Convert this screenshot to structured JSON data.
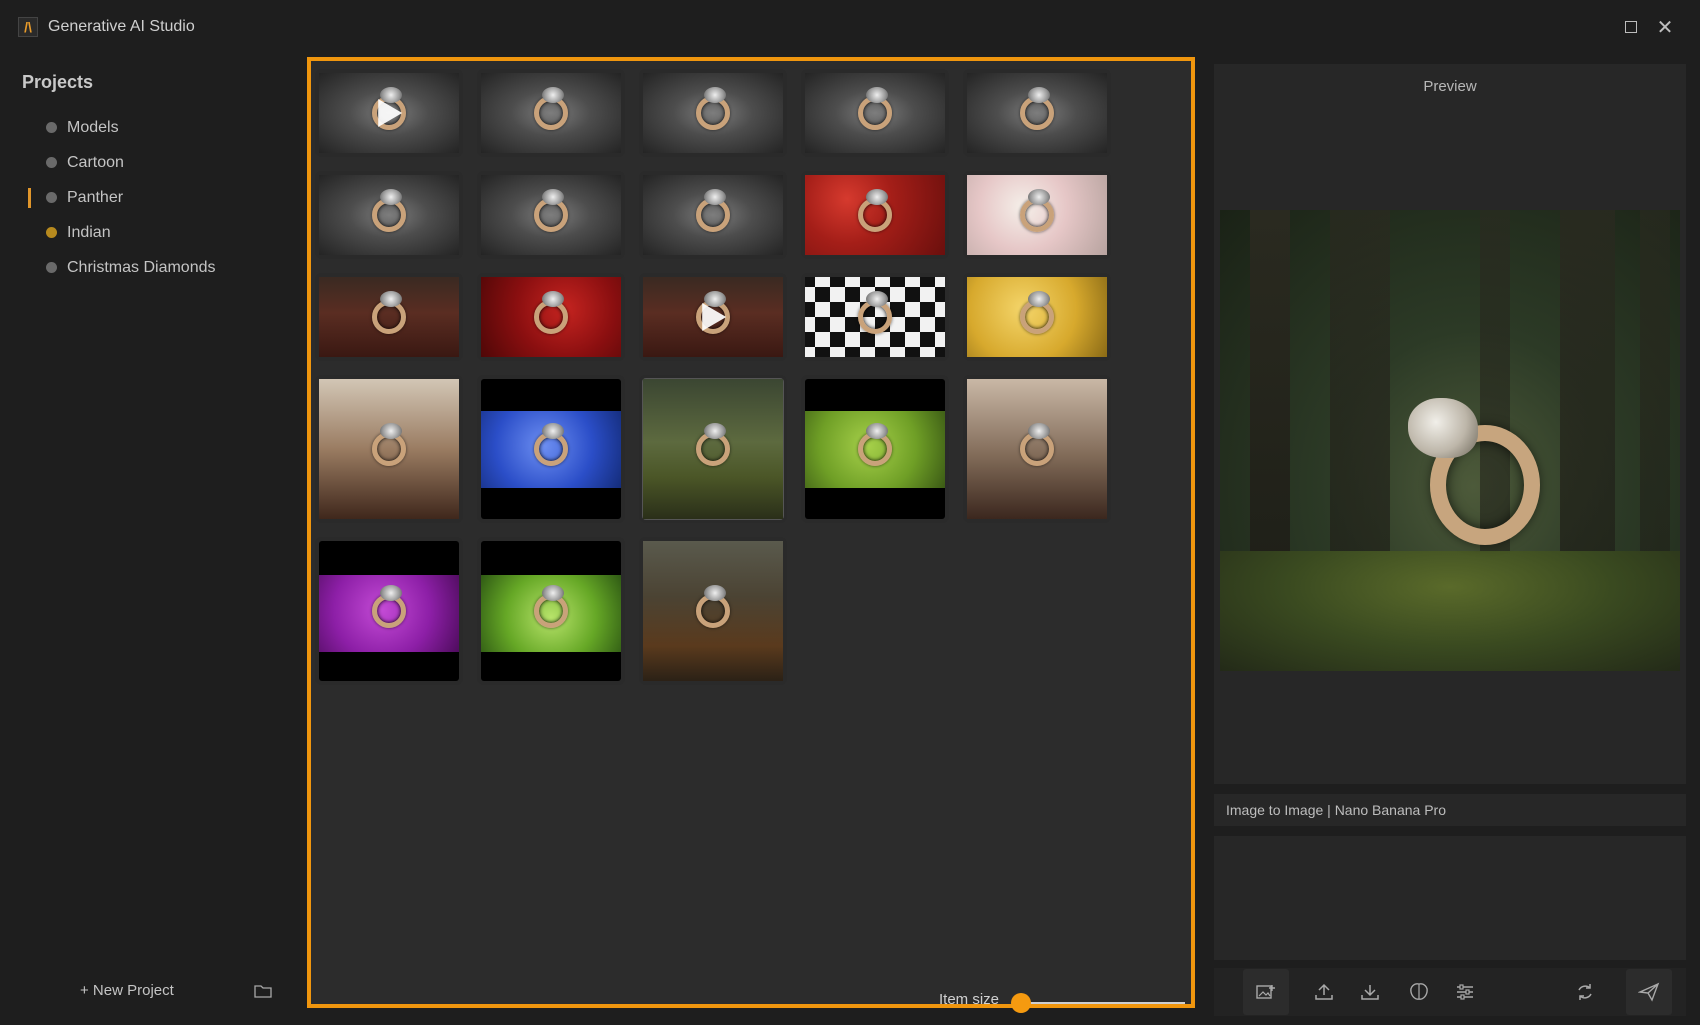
{
  "app": {
    "title": "Generative AI Studio"
  },
  "sidebar": {
    "heading": "Projects",
    "items": [
      {
        "label": "Models",
        "dot_color": "#6a6a6a"
      },
      {
        "label": "Cartoon",
        "dot_color": "#6a6a6a"
      },
      {
        "label": "Panther",
        "dot_color": "#6a6a6a",
        "active": true
      },
      {
        "label": "Indian",
        "dot_color": "#b78a1e"
      },
      {
        "label": "Christmas Diamonds",
        "dot_color": "#6a6a6a"
      }
    ],
    "new_project_label": "+ New Project"
  },
  "gallery": {
    "border_color": "#f0960e",
    "item_size_label": "Item size",
    "item_size_value": 0.0,
    "thumbnails": [
      {
        "scene": "gray-studio",
        "video": true
      },
      {
        "scene": "gray-studio"
      },
      {
        "scene": "gray-studio"
      },
      {
        "scene": "gray-studio"
      },
      {
        "scene": "gray-studio"
      },
      {
        "scene": "gray-studio"
      },
      {
        "scene": "gray-studio"
      },
      {
        "scene": "gray-studio"
      },
      {
        "scene": "red-roses"
      },
      {
        "scene": "white-pink-roses"
      },
      {
        "scene": "wood-table"
      },
      {
        "scene": "red-roses-2"
      },
      {
        "scene": "wood-table",
        "video": true
      },
      {
        "scene": "checkerboard"
      },
      {
        "scene": "yellow-roses"
      },
      {
        "scene": "showcase"
      },
      {
        "scene": "blue-flowers"
      },
      {
        "scene": "forest",
        "selected": true
      },
      {
        "scene": "green-roses"
      },
      {
        "scene": "jewelry-store"
      },
      {
        "scene": "purple-roses"
      },
      {
        "scene": "green-leaves"
      },
      {
        "scene": "autumn-forest"
      }
    ]
  },
  "preview": {
    "label": "Preview",
    "mode_text": "Image to Image | Nano Banana Pro"
  },
  "toolbar": {
    "icons": [
      "add-image-icon",
      "upload-icon",
      "download-icon",
      "brain-icon",
      "sliders-icon",
      "refresh-icon",
      "send-icon"
    ]
  }
}
